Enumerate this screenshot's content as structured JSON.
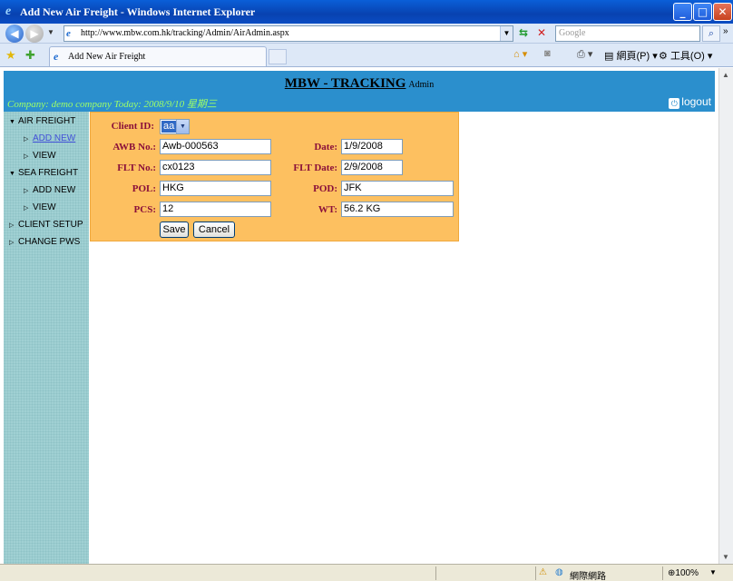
{
  "window": {
    "title": "Add New Air Freight - Windows Internet Explorer",
    "min_glyph": "_",
    "max_glyph": "□",
    "close_glyph": "✕"
  },
  "browser": {
    "url": "http://www.mbw.com.hk/tracking/Admin/AirAdmin.aspx",
    "search_placeholder": "Google",
    "tab_title": "Add New Air Freight",
    "page_menu": "網頁(P)",
    "tools_menu": "工具(O)",
    "overflow": "»"
  },
  "banner": {
    "brand": "MBW - TRACKING",
    "admin": "Admin",
    "info": "Company: demo company Today: 2008/9/10 星期三",
    "logout": "logout"
  },
  "sidebar": {
    "items": [
      {
        "label": "AIR FREIGHT"
      },
      {
        "label": "ADD NEW"
      },
      {
        "label": "VIEW"
      },
      {
        "label": "SEA FREIGHT"
      },
      {
        "label": "ADD NEW"
      },
      {
        "label": "VIEW"
      },
      {
        "label": "CLIENT SETUP"
      },
      {
        "label": "CHANGE PWS"
      }
    ]
  },
  "form": {
    "client_id_label": "Client ID:",
    "client_id_value": "aa",
    "awb_label": "AWB No.:",
    "awb_value": "Awb-000563",
    "date_label": "Date:",
    "date_value": "1/9/2008",
    "flt_no_label": "FLT No.:",
    "flt_no_value": "cx0123",
    "flt_date_label": "FLT Date:",
    "flt_date_value": "2/9/2008",
    "pol_label": "POL:",
    "pol_value": "HKG",
    "pod_label": "POD:",
    "pod_value": "JFK",
    "pcs_label": "PCS:",
    "pcs_value": "12",
    "wt_label": "WT:",
    "wt_value": "56.2 KG",
    "save_label": "Save",
    "cancel_label": "Cancel"
  },
  "statusbar": {
    "zone": "網際網路",
    "zoom": "100%"
  }
}
